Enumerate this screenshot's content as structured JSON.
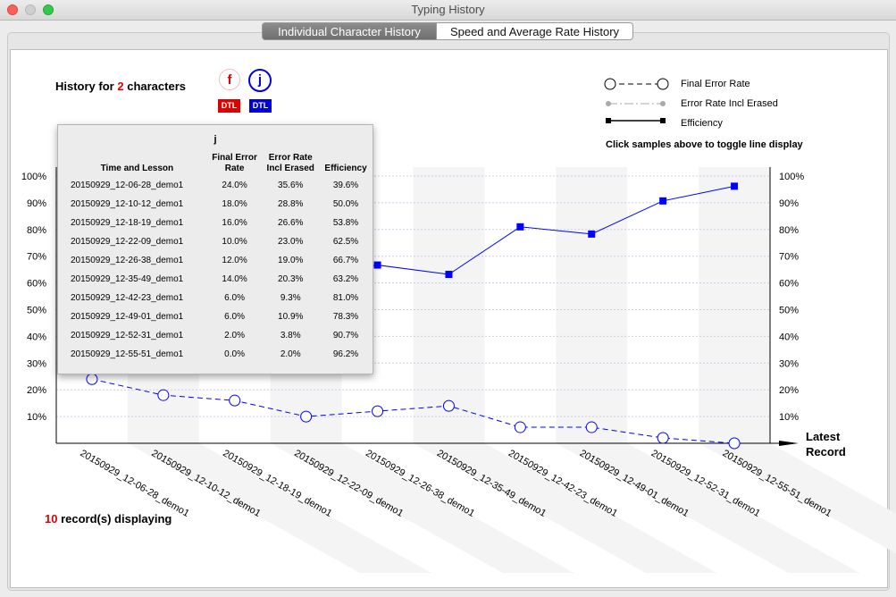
{
  "window": {
    "title": "Typing History"
  },
  "tabs": [
    {
      "label": "Individual Character History",
      "active": true
    },
    {
      "label": "Speed and Average Rate History",
      "active": false
    }
  ],
  "header": {
    "history_prefix": "History for",
    "count": "2",
    "history_suffix": "characters",
    "characters": [
      {
        "char": "f",
        "color": "#e00000",
        "dtl": "DTL"
      },
      {
        "char": "j",
        "color": "#0000dd",
        "dtl": "DTL"
      }
    ]
  },
  "legend": {
    "items": [
      "Final Error Rate",
      "Error Rate Incl Erased",
      "Efficiency"
    ],
    "hint": "Click samples above to toggle line display"
  },
  "footer": {
    "records_count": "10",
    "records_label": "record(s) displaying"
  },
  "axis": {
    "latest_line1": "Latest",
    "latest_line2": "Record"
  },
  "popup": {
    "title": "j",
    "headers": [
      "Time and Lesson",
      "Final Error Rate",
      "Error Rate Incl Erased",
      "Efficiency"
    ],
    "rows": [
      [
        "20150929_12-06-28_demo1",
        "24.0%",
        "35.6%",
        "39.6%"
      ],
      [
        "20150929_12-10-12_demo1",
        "18.0%",
        "28.8%",
        "50.0%"
      ],
      [
        "20150929_12-18-19_demo1",
        "16.0%",
        "26.6%",
        "53.8%"
      ],
      [
        "20150929_12-22-09_demo1",
        "10.0%",
        "23.0%",
        "62.5%"
      ],
      [
        "20150929_12-26-38_demo1",
        "12.0%",
        "19.0%",
        "66.7%"
      ],
      [
        "20150929_12-35-49_demo1",
        "14.0%",
        "20.3%",
        "63.2%"
      ],
      [
        "20150929_12-42-23_demo1",
        "6.0%",
        "9.3%",
        "81.0%"
      ],
      [
        "20150929_12-49-01_demo1",
        "6.0%",
        "10.9%",
        "78.3%"
      ],
      [
        "20150929_12-52-31_demo1",
        "2.0%",
        "3.8%",
        "90.7%"
      ],
      [
        "20150929_12-55-51_demo1",
        "0.0%",
        "2.0%",
        "96.2%"
      ]
    ]
  },
  "chart_data": {
    "type": "line",
    "categories": [
      "20150929_12-06-28_demo1",
      "20150929_12-10-12_demo1",
      "20150929_12-18-19_demo1",
      "20150929_12-22-09_demo1",
      "20150929_12-26-38_demo1",
      "20150929_12-35-49_demo1",
      "20150929_12-42-23_demo1",
      "20150929_12-49-01_demo1",
      "20150929_12-52-31_demo1",
      "20150929_12-55-51_demo1"
    ],
    "yticks": [
      "10%",
      "20%",
      "30%",
      "40%",
      "50%",
      "60%",
      "70%",
      "80%",
      "90%",
      "100%"
    ],
    "ylim": [
      0,
      100
    ],
    "series": [
      {
        "name": "Final Error Rate",
        "color": "#0000ff",
        "style": "dashed-circle",
        "values": [
          24.0,
          18.0,
          16.0,
          10.0,
          12.0,
          14.0,
          6.0,
          6.0,
          2.0,
          0.0
        ]
      },
      {
        "name": "Efficiency",
        "color": "#0000ff",
        "style": "solid-square",
        "values": [
          39.6,
          50.0,
          53.8,
          62.5,
          66.7,
          63.2,
          81.0,
          78.3,
          90.7,
          96.2
        ]
      }
    ],
    "grid": true,
    "legend": "top-right"
  }
}
